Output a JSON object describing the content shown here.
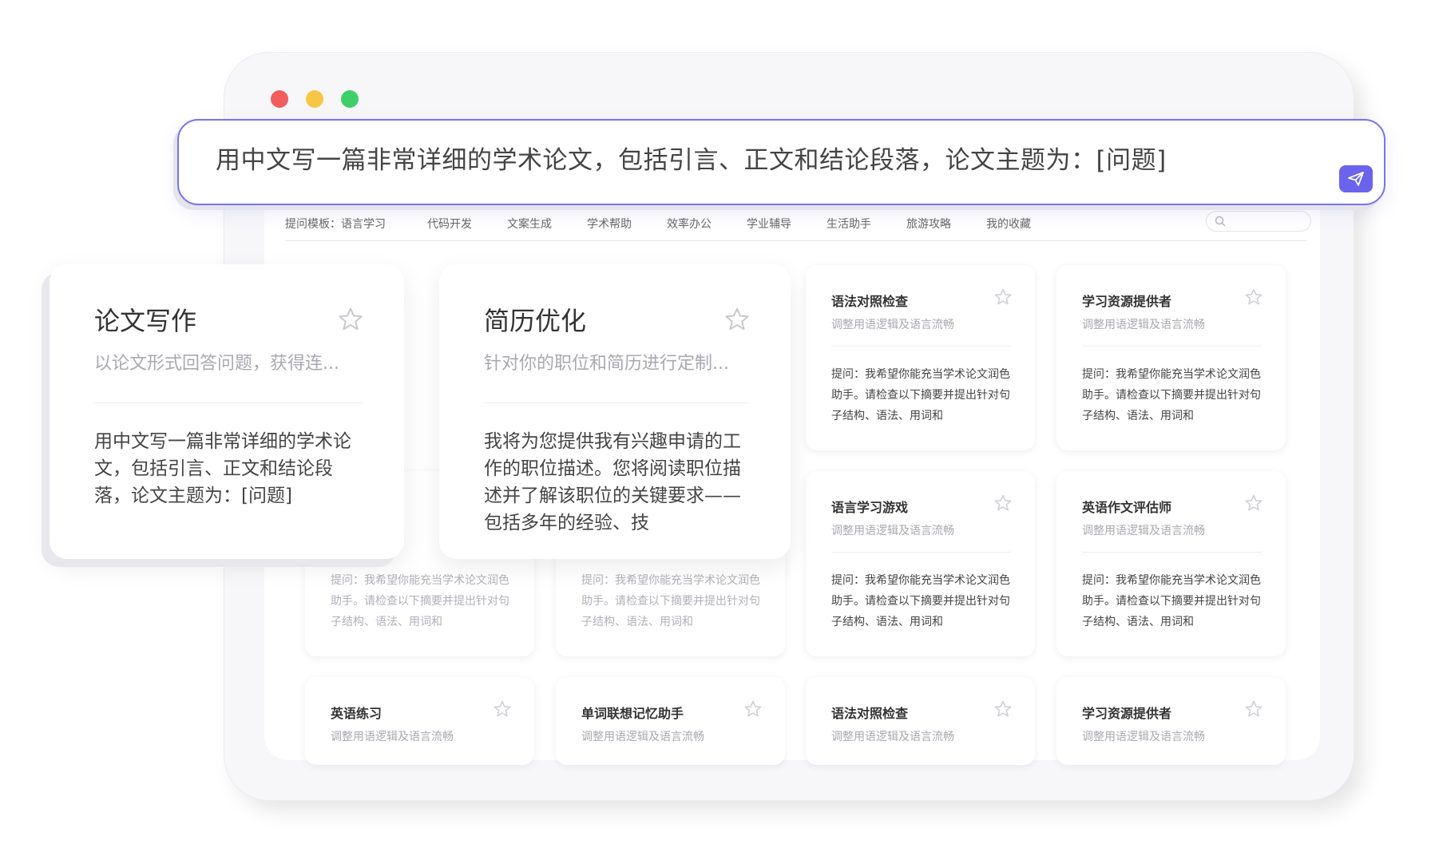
{
  "prompt": {
    "text": "用中文写一篇非常详细的学术论文，包括引言、正文和结论段落，论文主题为：[问题]"
  },
  "tabs": {
    "label": "提问模板：",
    "items": [
      "语言学习",
      "代码开发",
      "文案生成",
      "学术帮助",
      "效率办公",
      "学业辅导",
      "生活助手",
      "旅游攻略",
      "我的收藏"
    ]
  },
  "featured": [
    {
      "title": "论文写作",
      "subtitle": "以论文形式回答问题，获得连...",
      "body": "用中文写一篇非常详细的学术论文，包括引言、正文和结论段落，论文主题为：[问题]"
    },
    {
      "title": "简历优化",
      "subtitle": "针对你的职位和简历进行定制...",
      "body": "我将为您提供我有兴趣申请的工作的职位描述。您将阅读职位描述并了解该职位的关键要求——包括多年的经验、技"
    }
  ],
  "cards": {
    "r1c3": {
      "title": "语法对照检查",
      "subtitle": "调整用语逻辑及语言流畅",
      "body": "提问：我希望你能充当学术论文润色助手。请检查以下摘要并提出针对句子结构、语法、用词和"
    },
    "r1c4": {
      "title": "学习资源提供者",
      "subtitle": "调整用语逻辑及语言流畅",
      "body": "提问：我希望你能充当学术论文润色助手。请检查以下摘要并提出针对句子结构、语法、用词和"
    },
    "r2c1": {
      "body": "提问：我希望你能充当学术论文润色助手。请检查以下摘要并提出针对句子结构、语法、用词和"
    },
    "r2c2": {
      "body": "提问：我希望你能充当学术论文润色助手。请检查以下摘要并提出针对句子结构、语法、用词和"
    },
    "r2c3": {
      "title": "语言学习游戏",
      "subtitle": "调整用语逻辑及语言流畅",
      "body": "提问：我希望你能充当学术论文润色助手。请检查以下摘要并提出针对句子结构、语法、用词和"
    },
    "r2c4": {
      "title": "英语作文评估师",
      "subtitle": "调整用语逻辑及语言流畅",
      "body": "提问：我希望你能充当学术论文润色助手。请检查以下摘要并提出针对句子结构、语法、用词和"
    },
    "r3c1": {
      "title": "英语练习",
      "subtitle": "调整用语逻辑及语言流畅"
    },
    "r3c2": {
      "title": "单词联想记忆助手",
      "subtitle": "调整用语逻辑及语言流畅"
    },
    "r3c3": {
      "title": "语法对照检查",
      "subtitle": "调整用语逻辑及语言流畅"
    },
    "r3c4": {
      "title": "学习资源提供者",
      "subtitle": "调整用语逻辑及语言流畅"
    }
  },
  "colors": {
    "accent": "#6b63ec",
    "border_accent": "#7a72f0",
    "dot_red": "#f25d5d",
    "dot_yellow": "#f8c545",
    "dot_green": "#3fcf68"
  },
  "icons": {
    "send": "paper-plane-icon",
    "favorite": "star-outline-icon",
    "search": "search-icon"
  }
}
